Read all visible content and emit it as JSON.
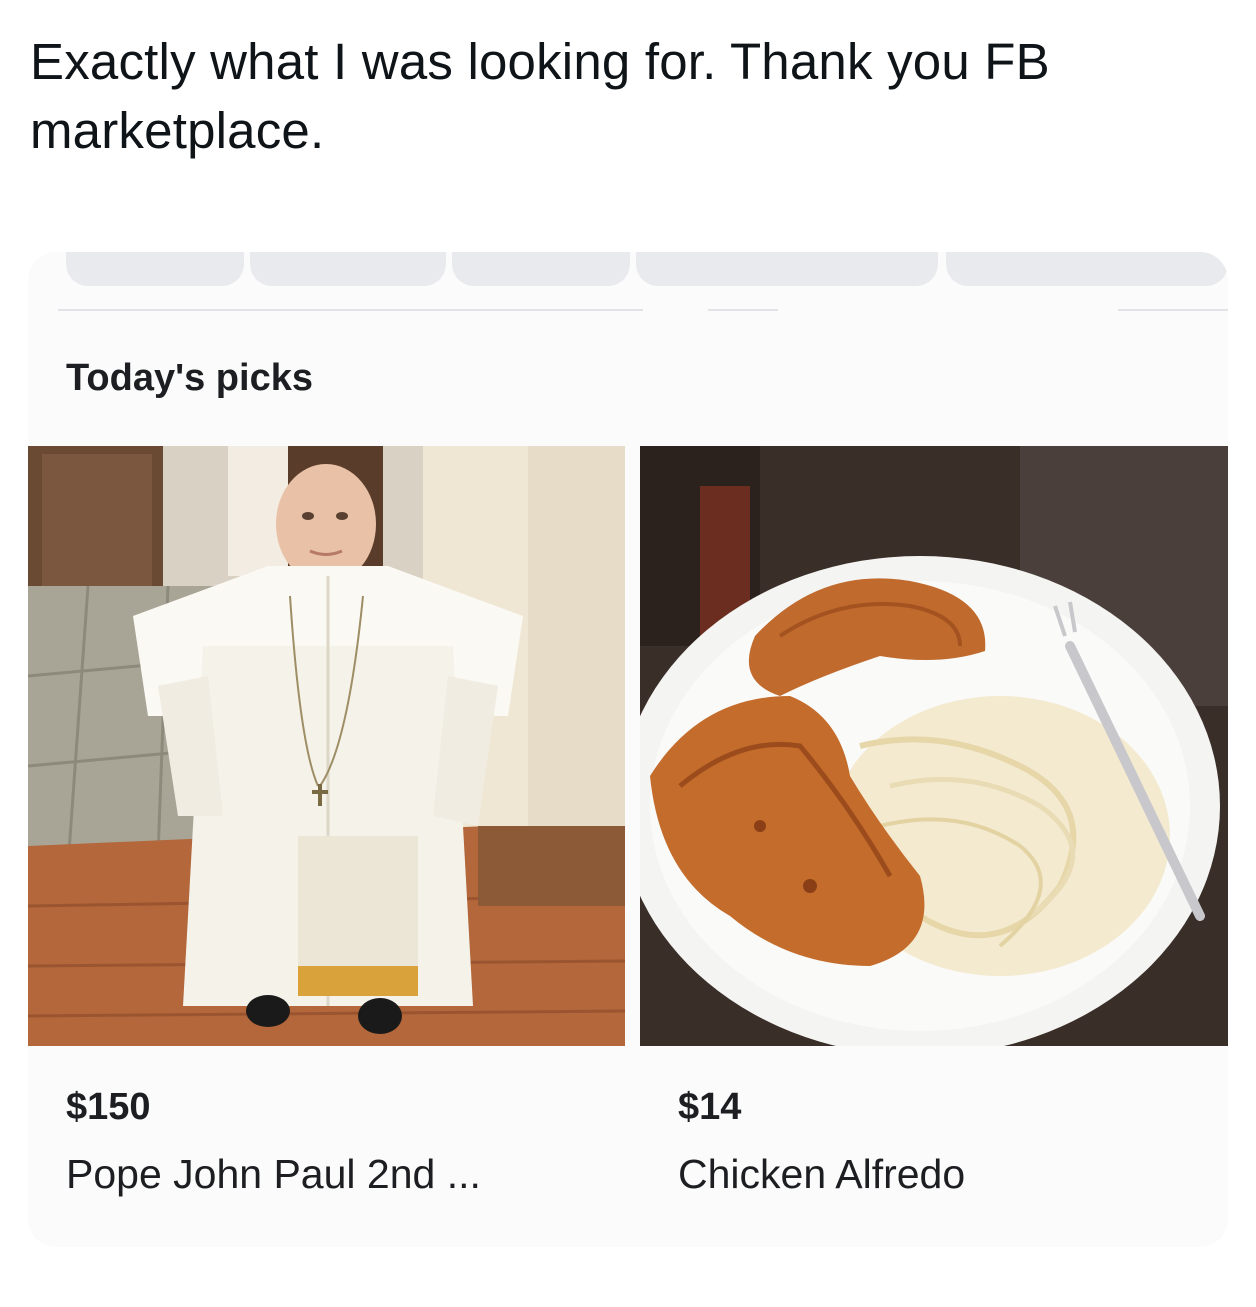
{
  "post": {
    "text": "Exactly what I was looking for. Thank you FB marketplace."
  },
  "marketplace": {
    "section_title": "Today's picks",
    "listings": [
      {
        "price": "$150",
        "title": "Pope John Paul 2nd ...",
        "image_icon": "pope-doll-photo"
      },
      {
        "price": "$14",
        "title": "Chicken Alfredo",
        "image_icon": "chicken-alfredo-photo"
      }
    ]
  },
  "colors": {
    "card_background": "#fbfbfc",
    "pill_background": "#e9eaed",
    "text": "#1c1e21"
  }
}
